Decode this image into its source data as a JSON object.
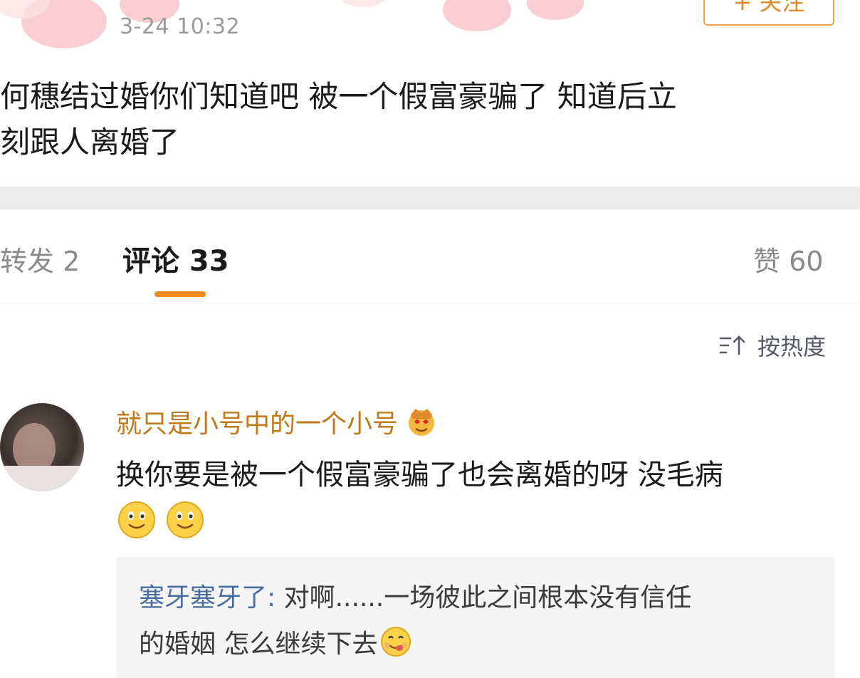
{
  "post": {
    "timestamp": "3-24 10:32",
    "follow_label": "+ 关注",
    "text_lines": [
      "何穗结过婚你们知道吧  被一个假富豪骗了  知道后立",
      "刻跟人离婚了"
    ]
  },
  "tabs": {
    "repost": "转发 2",
    "comments": "评论 33",
    "likes": "赞 60"
  },
  "sort": {
    "label": "按热度",
    "icon": "sort-icon"
  },
  "comment": {
    "author": "就只是小号中的一个小号",
    "badge_icon": "crown-emoji-icon",
    "text": "换你要是被一个假富豪骗了也会离婚的呀 没毛病",
    "emojis": [
      "smile-emoji-icon",
      "smile-emoji-icon"
    ],
    "reply": {
      "author": "塞牙塞牙了:",
      "text_line1": " 对啊......一场彼此之间根本没有信任",
      "text_line2": "的婚姻 怎么继续下去",
      "emoji": "yum-emoji-icon"
    }
  },
  "colors": {
    "accent_orange": "#f08a24",
    "author_gold": "#c07a1b",
    "reply_author_blue": "#4a6ea1"
  }
}
